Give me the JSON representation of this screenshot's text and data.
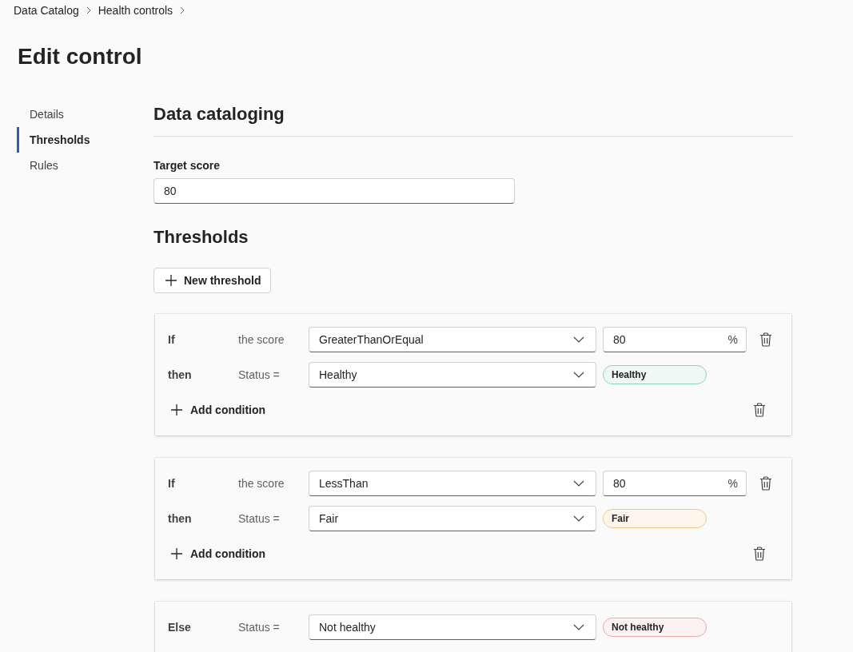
{
  "breadcrumb": [
    {
      "label": "Data Catalog"
    },
    {
      "label": "Health controls"
    }
  ],
  "title": "Edit control",
  "nav": [
    {
      "label": "Details",
      "selected": false
    },
    {
      "label": "Thresholds",
      "selected": true
    },
    {
      "label": "Rules",
      "selected": false
    }
  ],
  "section_title": "Data cataloging",
  "target_score": {
    "label": "Target score",
    "value": "80"
  },
  "thresholds_title": "Thresholds",
  "new_threshold_button": "New threshold",
  "thresholds": [
    {
      "kind": "condition",
      "if_label": "If",
      "subject": "the score",
      "operator": "GreaterThanOrEqual",
      "value": "80",
      "unit": "%",
      "then_label": "then",
      "status_label": "Status =",
      "status": "Healthy",
      "badge": "Healthy",
      "color": "#8fd3b6",
      "add_condition": "Add condition"
    },
    {
      "kind": "condition",
      "if_label": "If",
      "subject": "the score",
      "operator": "LessThan",
      "value": "80",
      "unit": "%",
      "then_label": "then",
      "status_label": "Status =",
      "status": "Fair",
      "badge": "Fair",
      "color": "#f5c58a",
      "add_condition": "Add condition"
    },
    {
      "kind": "else",
      "if_label": "Else",
      "status_label": "Status =",
      "status": "Not healthy",
      "badge": "Not healthy",
      "color": "#eba8a8"
    }
  ]
}
